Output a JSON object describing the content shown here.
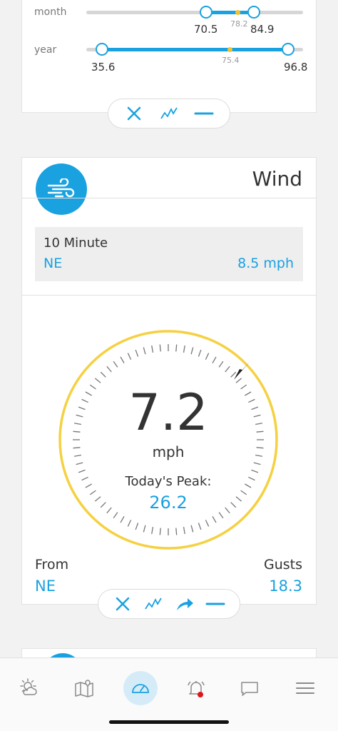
{
  "ranges": {
    "month": {
      "label": "month",
      "low": "70.5",
      "mid": "78.2",
      "high": "84.9"
    },
    "year": {
      "label": "year",
      "low": "35.6",
      "mid": "75.4",
      "high": "96.8"
    }
  },
  "toolbar_top": {
    "icons": [
      "close-icon",
      "trend-line-icon",
      "minus-icon"
    ]
  },
  "wind": {
    "title": "Wind",
    "ten_minute": {
      "label": "10 Minute",
      "direction": "NE",
      "speed": "8.5 mph"
    },
    "speed": "7.2",
    "unit": "mph",
    "peak_label": "Today's Peak:",
    "peak_value": "26.2",
    "from_label": "From",
    "from_value": "NE",
    "gusts_label": "Gusts",
    "gusts_value": "18.3"
  },
  "toolbar_wind": {
    "icons": [
      "close-icon",
      "trend-line-icon",
      "share-arrow-icon",
      "minus-icon"
    ]
  },
  "tabs": [
    {
      "name": "weather-tab",
      "icon": "sun-cloud-icon"
    },
    {
      "name": "map-tab",
      "icon": "map-icon"
    },
    {
      "name": "dashboard-tab",
      "icon": "gauge-icon",
      "active": true
    },
    {
      "name": "alerts-tab",
      "icon": "bell-icon",
      "badge": true
    },
    {
      "name": "messages-tab",
      "icon": "chat-icon"
    },
    {
      "name": "menu-tab",
      "icon": "hamburger-icon"
    }
  ],
  "colors": {
    "accent": "#1aa1e0",
    "gauge_ring": "#f5d142",
    "alert_badge": "#e0151b"
  }
}
